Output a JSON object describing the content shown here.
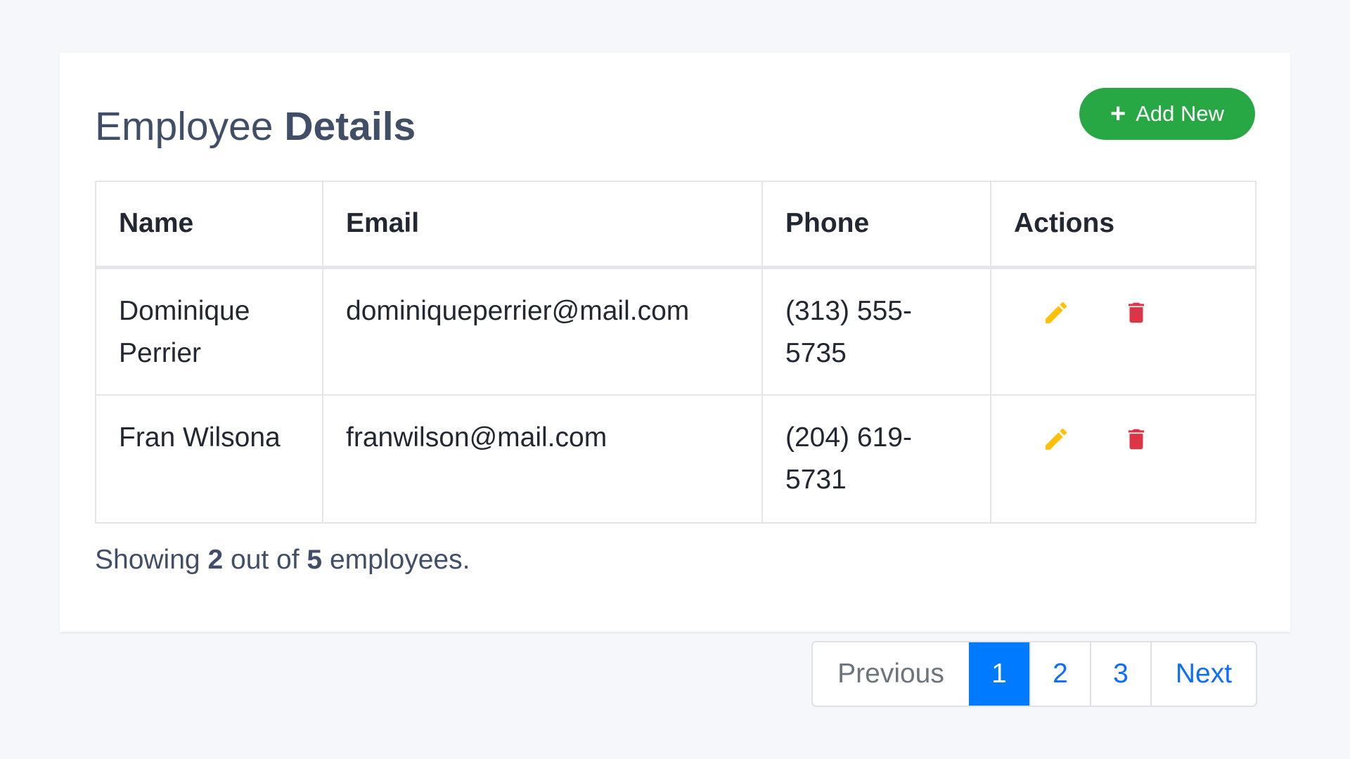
{
  "header": {
    "title_regular": "Employee",
    "title_bold": "Details",
    "add_button_label": "Add New",
    "add_button_color": "#28a745"
  },
  "table": {
    "columns": [
      "Name",
      "Email",
      "Phone",
      "Actions"
    ],
    "rows": [
      {
        "name": "Dominique Perrier",
        "email": "dominiqueperrier@mail.com",
        "phone": "(313) 555-5735"
      },
      {
        "name": "Fran Wilsona",
        "email": "franwilson@mail.com",
        "phone": "(204) 619-5731"
      }
    ],
    "edit_icon": "pencil-icon",
    "delete_icon": "trash-icon",
    "edit_color": "#ffc107",
    "delete_color": "#dc3545"
  },
  "summary": {
    "prefix": "Showing",
    "shown": "2",
    "middle": "out of",
    "total": "5",
    "suffix": "employees."
  },
  "pagination": {
    "previous": "Previous",
    "pages": [
      "1",
      "2",
      "3"
    ],
    "active_page": "1",
    "next": "Next",
    "active_color": "#007bff"
  }
}
